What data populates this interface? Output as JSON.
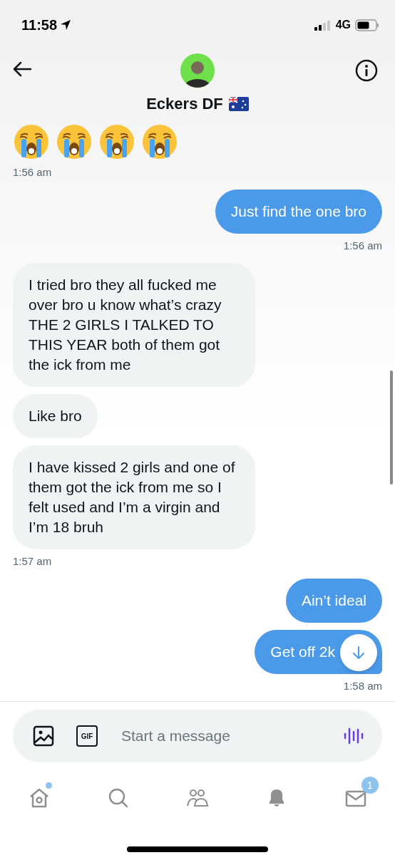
{
  "status_bar": {
    "time": "11:58",
    "network": "4G"
  },
  "header": {
    "name": "Eckers DF"
  },
  "messages": [
    {
      "kind": "emoji",
      "items": [
        {
          "kind": "loudly-crying"
        },
        {
          "kind": "loudly-crying"
        },
        {
          "kind": "loudly-crying"
        },
        {
          "kind": "loudly-crying"
        }
      ]
    },
    {
      "kind": "time",
      "sent": false,
      "text": "1:56 am"
    },
    {
      "kind": "text",
      "sent": true,
      "text": "Just find the one bro"
    },
    {
      "kind": "time",
      "sent": true,
      "text": "1:56 am"
    },
    {
      "kind": "text",
      "sent": false,
      "text": "I tried bro they all fucked me over bro u know what’s crazy THE 2 GIRLS I TALKED TO THIS YEAR both of them got the ick from me"
    },
    {
      "kind": "text",
      "sent": false,
      "text": "Like bro"
    },
    {
      "kind": "text",
      "sent": false,
      "text": "I have kissed 2 girls and one of them got the ick from me so I felt used and I’m a virgin and I’m 18 bruh"
    },
    {
      "kind": "time",
      "sent": false,
      "text": "1:57 am"
    },
    {
      "kind": "text",
      "sent": true,
      "text": "Ain’t ideal"
    },
    {
      "kind": "text",
      "sent": true,
      "text": "Get off 2k"
    },
    {
      "kind": "time",
      "sent": true,
      "text": "1:58 am"
    }
  ],
  "composer": {
    "placeholder": "Start a message",
    "gif_label": "GIF"
  },
  "tab_bar": [
    {
      "kind": "home",
      "selected": false,
      "dot": true
    },
    {
      "kind": "search",
      "selected": false
    },
    {
      "kind": "communities",
      "selected": false
    },
    {
      "kind": "notifications",
      "selected": false
    },
    {
      "kind": "messages",
      "selected": false,
      "badge": "1"
    }
  ]
}
